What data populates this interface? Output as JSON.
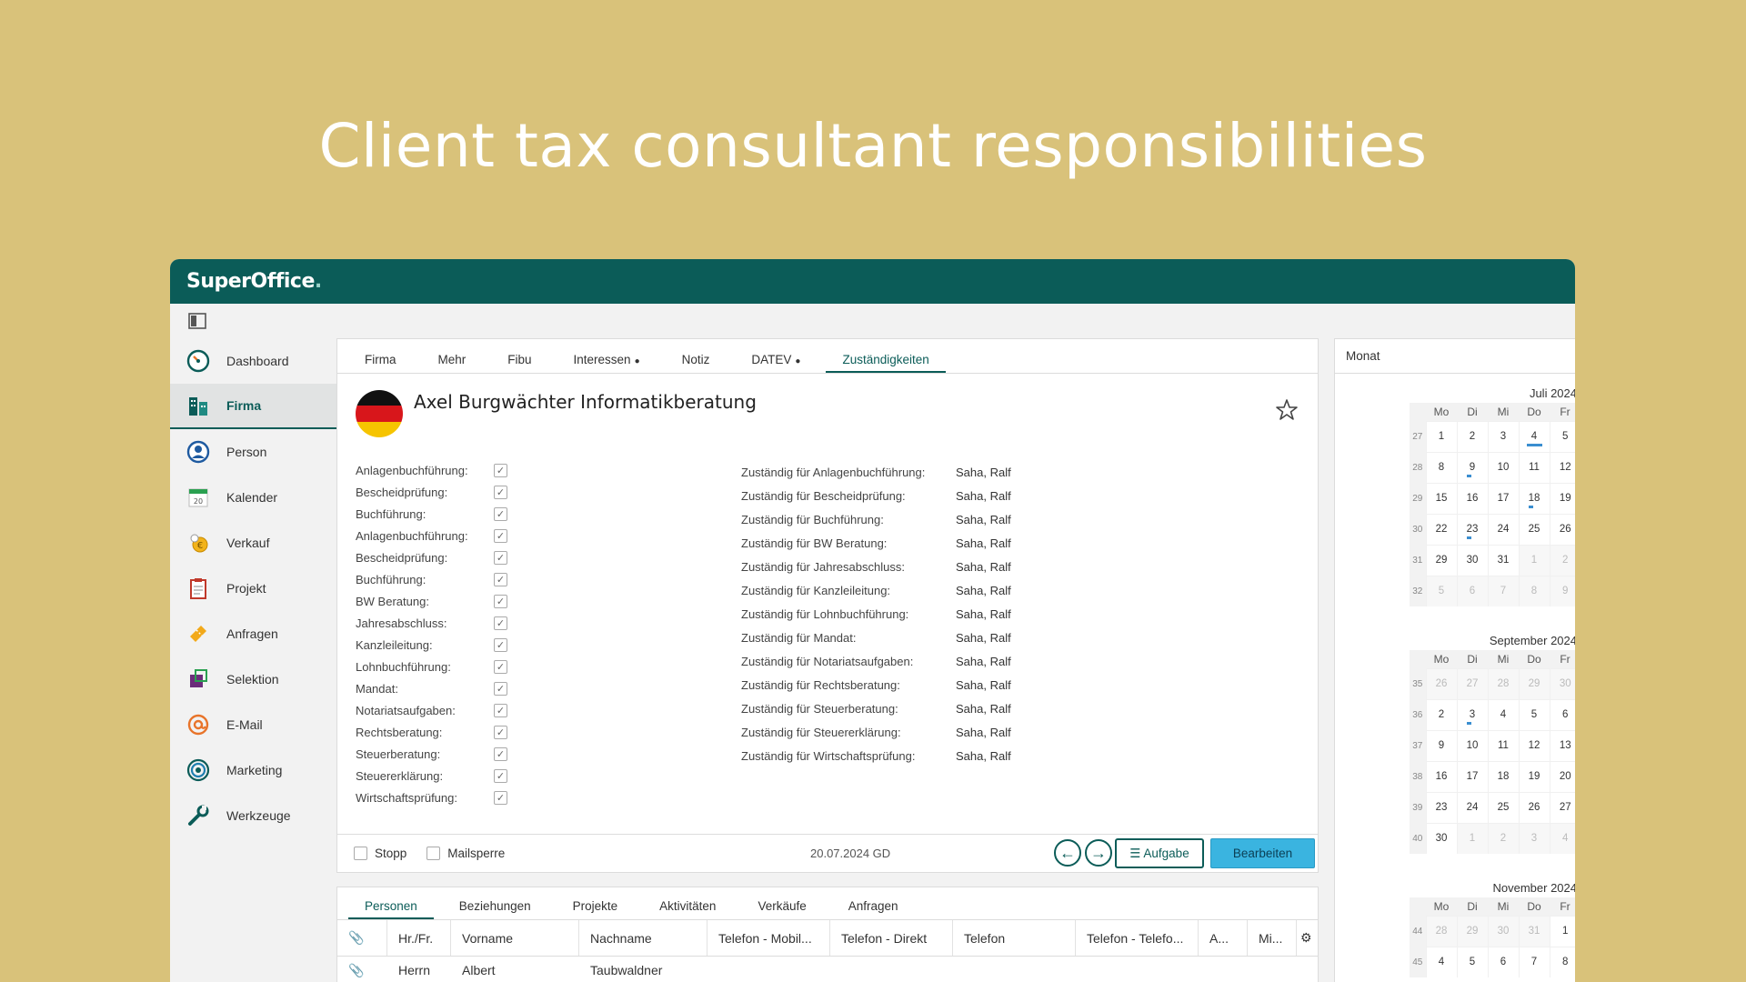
{
  "headline": "Client tax consultant responsibilities",
  "app": {
    "logo": "SuperOffice",
    "logo_dot": ".",
    "accent_color": "#0b5c58",
    "button_color": "#3ab4e0"
  },
  "sidebar": {
    "items": [
      {
        "label": "Dashboard",
        "icon": "dashboard-gauge-icon"
      },
      {
        "label": "Firma",
        "icon": "company-buildings-icon"
      },
      {
        "label": "Person",
        "icon": "person-icon"
      },
      {
        "label": "Kalender",
        "icon": "calendar-icon"
      },
      {
        "label": "Verkauf",
        "icon": "sale-coins-icon"
      },
      {
        "label": "Projekt",
        "icon": "project-clipboard-icon"
      },
      {
        "label": "Anfragen",
        "icon": "requests-ticket-icon"
      },
      {
        "label": "Selektion",
        "icon": "selection-icon"
      },
      {
        "label": "E-Mail",
        "icon": "email-at-icon"
      },
      {
        "label": "Marketing",
        "icon": "marketing-target-icon"
      },
      {
        "label": "Werkzeuge",
        "icon": "tools-wrench-icon"
      }
    ]
  },
  "tabs": [
    {
      "label": "Firma"
    },
    {
      "label": "Mehr"
    },
    {
      "label": "Fibu"
    },
    {
      "label": "Interessen",
      "bullet": "●"
    },
    {
      "label": "Notiz"
    },
    {
      "label": "DATEV",
      "bullet": "●"
    },
    {
      "label": "Zuständigkeiten"
    }
  ],
  "company": {
    "name": "Axel Burgwächter Informatikberatung",
    "flag": "germany-flag"
  },
  "checkboxes": [
    {
      "label": "Anlagenbuchführung:",
      "checked": true
    },
    {
      "label": "Bescheidprüfung:",
      "checked": true
    },
    {
      "label": "Buchführung:",
      "checked": true
    },
    {
      "label": "Anlagenbuchführung:",
      "checked": true
    },
    {
      "label": "Bescheidprüfung:",
      "checked": true
    },
    {
      "label": "Buchführung:",
      "checked": true
    },
    {
      "label": "BW Beratung:",
      "checked": true
    },
    {
      "label": "Jahresabschluss:",
      "checked": true
    },
    {
      "label": "Kanzleileitung:",
      "checked": true
    },
    {
      "label": "Lohnbuchführung:",
      "checked": true
    },
    {
      "label": "Mandat:",
      "checked": true
    },
    {
      "label": "Notariatsaufgaben:",
      "checked": true
    },
    {
      "label": "Rechtsberatung:",
      "checked": true
    },
    {
      "label": "Steuerberatung:",
      "checked": true
    },
    {
      "label": "Steuererklärung:",
      "checked": true
    },
    {
      "label": "Wirtschaftsprüfung:",
      "checked": true
    }
  ],
  "responsibilities": [
    {
      "key": "Zuständig für Anlagenbuchführung:",
      "value": "Saha, Ralf"
    },
    {
      "key": "Zuständig für Bescheidprüfung:",
      "value": "Saha, Ralf"
    },
    {
      "key": "Zuständig für Buchführung:",
      "value": "Saha, Ralf"
    },
    {
      "key": "Zuständig für BW Beratung:",
      "value": "Saha, Ralf"
    },
    {
      "key": "Zuständig für Jahresabschluss:",
      "value": "Saha, Ralf"
    },
    {
      "key": "Zuständig für Kanzleileitung:",
      "value": "Saha, Ralf"
    },
    {
      "key": "Zuständig für Lohnbuchführung:",
      "value": "Saha, Ralf"
    },
    {
      "key": "Zuständig für Mandat:",
      "value": "Saha, Ralf"
    },
    {
      "key": "Zuständig für Notariatsaufgaben:",
      "value": "Saha, Ralf"
    },
    {
      "key": "Zuständig für Rechtsberatung:",
      "value": "Saha, Ralf"
    },
    {
      "key": "Zuständig für Steuerberatung:",
      "value": "Saha, Ralf"
    },
    {
      "key": "Zuständig für Steuererklärung:",
      "value": "Saha, Ralf"
    },
    {
      "key": "Zuständig für Wirtschaftsprüfung:",
      "value": "Saha, Ralf"
    }
  ],
  "footer": {
    "stopp": "Stopp",
    "mailsperre": "Mailsperre",
    "date": "20.07.2024 GD",
    "task_button": "Aufgabe",
    "task_icon": "list-icon",
    "edit_button": "Bearbeiten"
  },
  "lower": {
    "tabs": [
      "Personen",
      "Beziehungen",
      "Projekte",
      "Aktivitäten",
      "Verkäufe",
      "Anfragen"
    ],
    "columns": [
      "Hr./Fr.",
      "Vorname",
      "Nachname",
      "Telefon - Mobil...",
      "Telefon - Direkt",
      "Telefon",
      "Telefon - Telefo...",
      "A...",
      "Mi..."
    ],
    "rows": [
      {
        "salutation": "Herrn",
        "first": "Albert",
        "last": "Taubwaldner"
      }
    ]
  },
  "calendar": {
    "view": "Monat",
    "weekday_headers": [
      "Mo",
      "Di",
      "Mi",
      "Do",
      "Fr"
    ],
    "months": [
      {
        "title": "Juli 2024",
        "weeks": [
          {
            "wk": "27",
            "days": [
              "1",
              "2",
              "3",
              "4",
              "5"
            ]
          },
          {
            "wk": "28",
            "days": [
              "8",
              "9",
              "10",
              "11",
              "12"
            ]
          },
          {
            "wk": "29",
            "days": [
              "15",
              "16",
              "17",
              "18",
              "19"
            ]
          },
          {
            "wk": "30",
            "days": [
              "22",
              "23",
              "24",
              "25",
              "26"
            ]
          },
          {
            "wk": "31",
            "days": [
              "29",
              "30",
              "31",
              "1",
              "2"
            ]
          },
          {
            "wk": "32",
            "days": [
              "5",
              "6",
              "7",
              "8",
              "9"
            ]
          }
        ]
      },
      {
        "title": "September 2024",
        "weeks": [
          {
            "wk": "35",
            "days": [
              "26",
              "27",
              "28",
              "29",
              "30"
            ]
          },
          {
            "wk": "36",
            "days": [
              "2",
              "3",
              "4",
              "5",
              "6"
            ]
          },
          {
            "wk": "37",
            "days": [
              "9",
              "10",
              "11",
              "12",
              "13"
            ]
          },
          {
            "wk": "38",
            "days": [
              "16",
              "17",
              "18",
              "19",
              "20"
            ]
          },
          {
            "wk": "39",
            "days": [
              "23",
              "24",
              "25",
              "26",
              "27"
            ]
          },
          {
            "wk": "40",
            "days": [
              "30",
              "1",
              "2",
              "3",
              "4"
            ]
          }
        ]
      },
      {
        "title": "November 2024",
        "weeks": [
          {
            "wk": "44",
            "days": [
              "28",
              "29",
              "30",
              "31",
              "1"
            ]
          },
          {
            "wk": "45",
            "days": [
              "4",
              "5",
              "6",
              "7",
              "8"
            ]
          }
        ]
      }
    ]
  }
}
